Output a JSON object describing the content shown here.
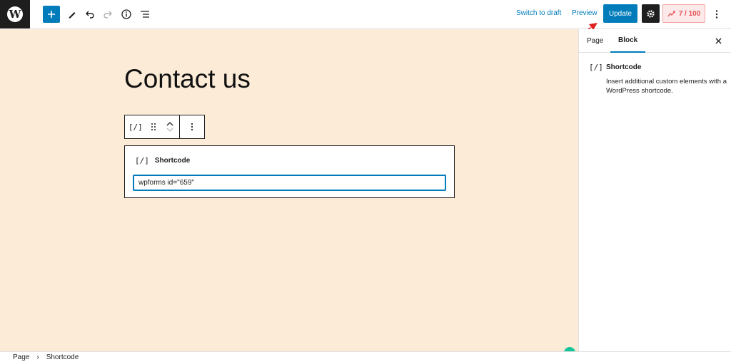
{
  "header": {
    "switch_to_draft": "Switch to draft",
    "preview": "Preview",
    "update": "Update",
    "score": "7 / 100"
  },
  "editor": {
    "page_title": "Contact us",
    "shortcode_label": "Shortcode",
    "shortcode_icon_text": "[/]",
    "shortcode_value": "wpforms id=\"659\""
  },
  "sidebar": {
    "tab_page": "Page",
    "tab_block": "Block",
    "block_icon_text": "[/]",
    "block_title": "Shortcode",
    "block_description": "Insert additional custom elements with a WordPress shortcode."
  },
  "breadcrumb": {
    "root": "Page",
    "separator": "›",
    "current": "Shortcode"
  },
  "colors": {
    "accent": "#007cba",
    "canvas": "#fbebd7",
    "score_text": "#e65054"
  }
}
